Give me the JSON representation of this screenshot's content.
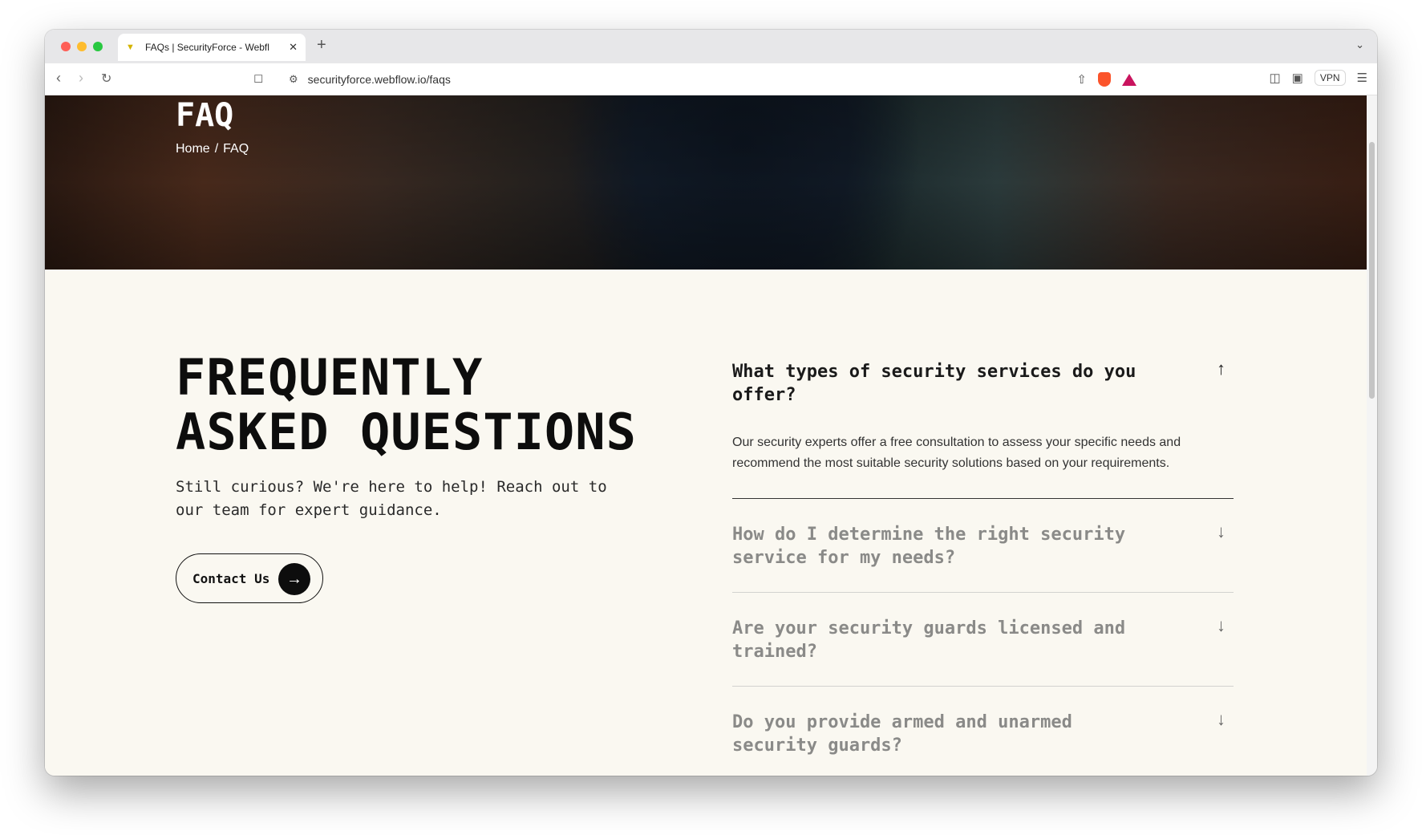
{
  "browser": {
    "tab_title": "FAQs | SecurityForce - Webfl",
    "url": "securityforce.webflow.io/faqs",
    "vpn_label": "VPN"
  },
  "hero": {
    "title": "FAQ",
    "breadcrumb": {
      "home": "Home",
      "separator": "/",
      "current": "FAQ"
    }
  },
  "faq_intro": {
    "heading_line1": "FREQUENTLY",
    "heading_line2": "ASKED QUESTIONS",
    "subtitle": "Still curious? We're here to help! Reach out to our team for expert guidance.",
    "contact_button": "Contact Us"
  },
  "faqs": [
    {
      "question": "What types of security services do you offer?",
      "answer": "Our security experts offer a free consultation to assess your specific needs and recommend the most suitable security solutions based on your requirements.",
      "expanded": true
    },
    {
      "question": "How do I determine the right security service for my needs?",
      "expanded": false
    },
    {
      "question": "Are your security guards licensed and trained?",
      "expanded": false
    },
    {
      "question": "Do you provide armed and unarmed security guards?",
      "expanded": false
    }
  ],
  "icons": {
    "up_arrow": "arrow-up-icon",
    "down_arrow": "arrow-down-icon",
    "right_arrow": "arrow-right-icon"
  },
  "colors": {
    "page_bg": "#faf8f1",
    "text_dark": "#0d0d0d",
    "text_muted": "#8a8a88"
  }
}
